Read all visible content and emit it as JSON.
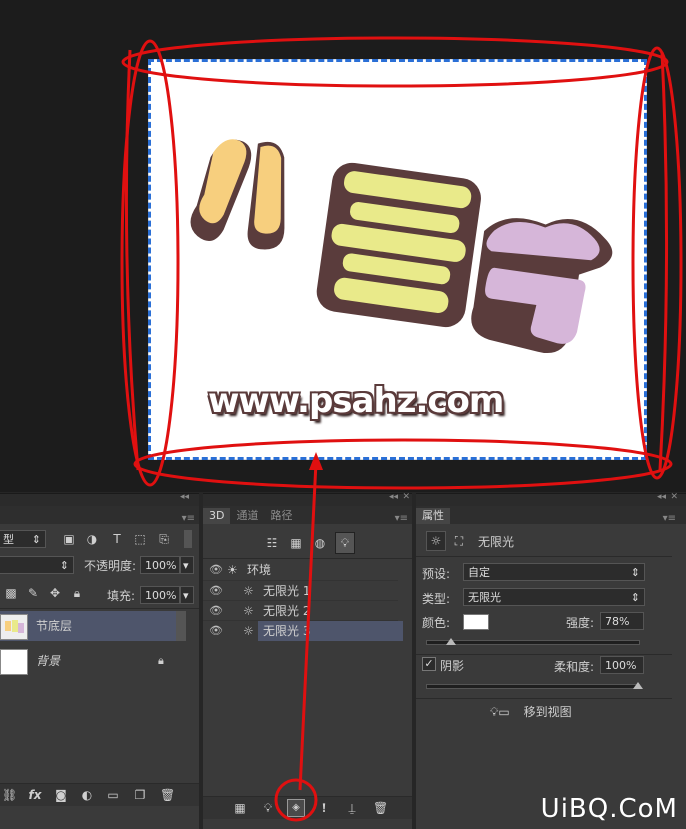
{
  "canvas": {
    "url_text": "www.psahz.com",
    "glyph_1": "儿",
    "glyph_2": "童",
    "glyph_3": "节"
  },
  "layers_panel": {
    "blend_mode": "型",
    "opacity_label": "不透明度:",
    "opacity_value": "100%",
    "fill_label": "填充:",
    "fill_value": "100%",
    "layers": [
      {
        "name": "节底层",
        "selected": true
      },
      {
        "name": "背景",
        "selected": false
      }
    ]
  },
  "threed_panel": {
    "tabs": [
      "3D",
      "通道",
      "路径"
    ],
    "items": [
      {
        "name": "环境",
        "level": 0
      },
      {
        "name": "无限光 1",
        "level": 1
      },
      {
        "name": "无限光 2",
        "level": 1
      },
      {
        "name": "无限光 3",
        "level": 1,
        "selected": true
      }
    ]
  },
  "properties_panel": {
    "tab": "属性",
    "header_title": "无限光",
    "preset_label": "预设:",
    "preset_value": "自定",
    "type_label": "类型:",
    "type_value": "无限光",
    "color_label": "颜色:",
    "color_value": "#ffffff",
    "intensity_label": "强度:",
    "intensity_value": "78%",
    "shadow_label": "阴影",
    "softness_label": "柔和度:",
    "softness_value": "100%",
    "move_to_view_label": "移到视图"
  },
  "watermark": "UiBQ.CoM",
  "colors": {
    "annotation": "#e01010",
    "selection": "#2a6fd6",
    "panel_bg": "#3a3a3a",
    "selected_row": "#4e556b"
  }
}
